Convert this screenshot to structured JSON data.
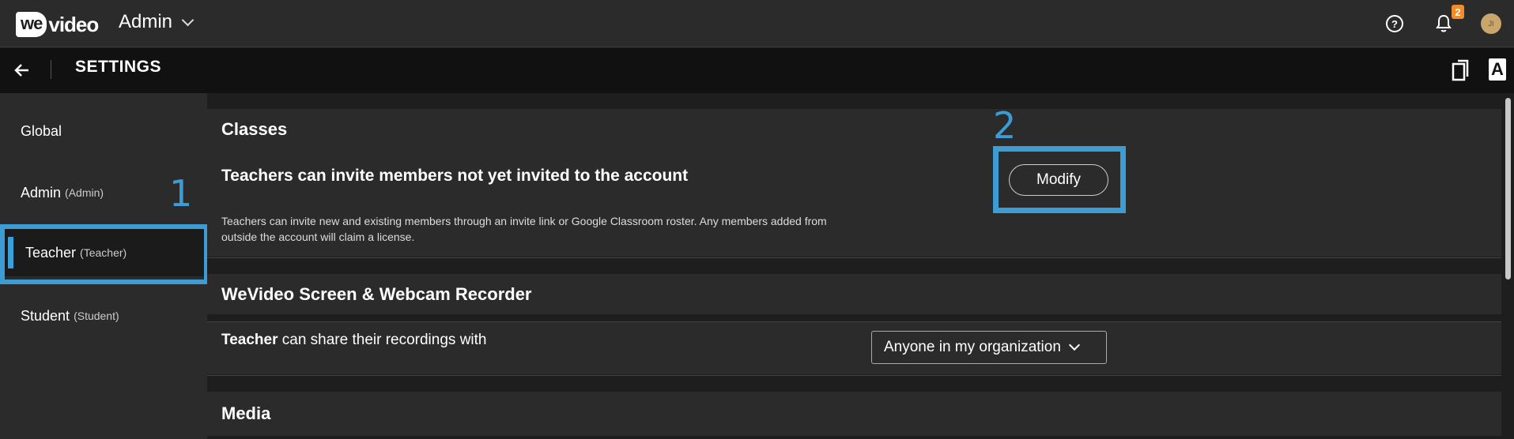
{
  "topbar": {
    "logo_badge": "we",
    "logo_rest": "video",
    "workspace": "Admin",
    "notification_count": "2",
    "avatar_initials": "JI"
  },
  "settings_bar": {
    "title": "SETTINGS",
    "font_icon_letter": "A"
  },
  "sidebar": {
    "items": [
      {
        "label": "Global",
        "sub": ""
      },
      {
        "label": "Admin",
        "sub": "(Admin)"
      },
      {
        "label": "Teacher",
        "sub": "(Teacher)"
      },
      {
        "label": "Student",
        "sub": "(Student)"
      }
    ],
    "active_index": 2
  },
  "annotations": {
    "one": "1",
    "two": "2"
  },
  "main": {
    "classes": {
      "heading": "Classes",
      "setting_title": "Teachers can invite members not yet invited to the account",
      "setting_desc_line1": "Teachers can invite new and existing members through an invite link or Google Classroom roster. Any members added from",
      "setting_desc_line2": "outside the account will claim a license.",
      "modify_label": "Modify"
    },
    "recorder": {
      "heading": "WeVideo Screen & Webcam Recorder",
      "share_role": "Teacher",
      "share_text": " can share their recordings with",
      "share_value": "Anyone in my organization"
    },
    "media": {
      "heading": "Media"
    }
  },
  "colors": {
    "accent": "#3d9cd4",
    "badge": "#f28c28"
  }
}
